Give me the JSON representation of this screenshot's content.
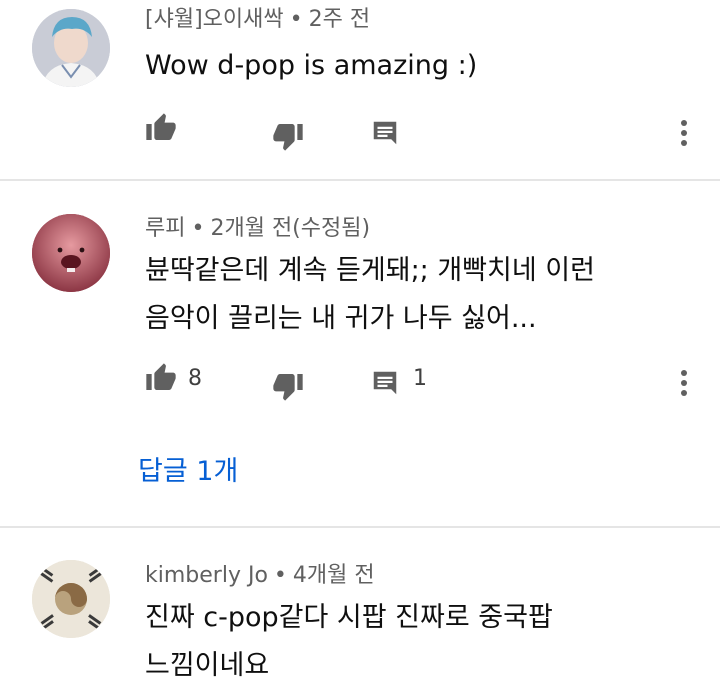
{
  "comments": [
    {
      "author": "[샤월]오이새싹",
      "time": "2주 전",
      "text_lines": [
        "Wow d-pop is amazing :)"
      ],
      "likes": "",
      "replies": ""
    },
    {
      "author": "루피",
      "time": "2개월 전(수정됨)",
      "text_lines": [
        "뷴딱같은데 계속 듣게돼;; 개빡치네 이런",
        "음악이 끌리는 내 귀가 나두 싫어..."
      ],
      "likes": "8",
      "replies": "1",
      "view_replies": "답글 1개"
    },
    {
      "author": "kimberly Jo",
      "time": "4개월 전",
      "text_lines": [
        "진짜 c-pop같다 시팝 진짜로 중국팝",
        "느낌이네요"
      ]
    }
  ],
  "separator": "•",
  "icons": {
    "like": "thumbs-up-icon",
    "dislike": "thumbs-down-icon",
    "reply": "comment-icon",
    "more": "more-vert-icon"
  },
  "colors": {
    "meta": "#606060",
    "link": "#065fd4",
    "icon": "#606060",
    "divider": "#e5e5e5"
  }
}
